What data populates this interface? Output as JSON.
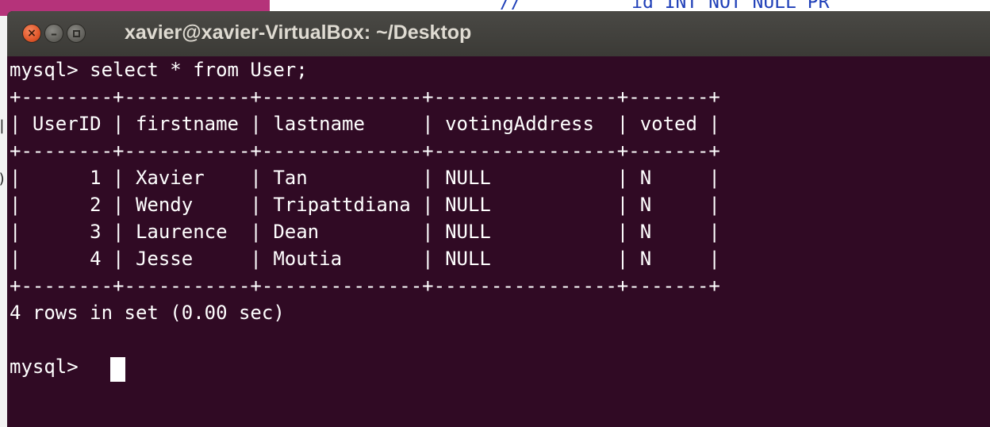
{
  "background": {
    "editor_text": "//          id INT NOT NULL PR"
  },
  "window": {
    "title": "xavier@xavier-VirtualBox: ~/Desktop",
    "buttons": {
      "close": "×",
      "minimize": "–"
    }
  },
  "terminal": {
    "command": "mysql> select * from User;",
    "table": {
      "border": "+--------+-----------+--------------+----------------+-------+",
      "header": "| UserID | firstname | lastname     | votingAddress  | voted |",
      "columns": [
        "UserID",
        "firstname",
        "lastname",
        "votingAddress",
        "voted"
      ],
      "rows": [
        "|      1 | Xavier    | Tan          | NULL           | N     |",
        "|      2 | Wendy     | Tripattdiana | NULL           | N     |",
        "|      3 | Laurence  | Dean         | NULL           | N     |",
        "|      4 | Jesse     | Moutia       | NULL           | N     |"
      ],
      "row_values": [
        [
          "1",
          "Xavier",
          "Tan",
          "NULL",
          "N"
        ],
        [
          "2",
          "Wendy",
          "Tripattdiana",
          "NULL",
          "N"
        ],
        [
          "3",
          "Laurence",
          "Dean",
          "NULL",
          "N"
        ],
        [
          "4",
          "Jesse",
          "Moutia",
          "NULL",
          "N"
        ]
      ]
    },
    "result": "4 rows in set (0.00 sec)",
    "prompt": "mysql> "
  },
  "colors": {
    "terminal_bg": "#300a24",
    "text": "#ffffff",
    "titlebar": "#3c3b37",
    "close_button": "#e95420"
  }
}
